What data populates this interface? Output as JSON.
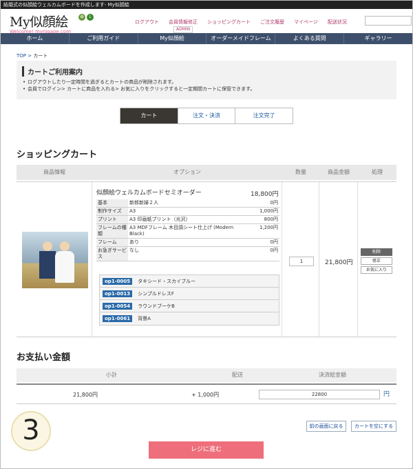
{
  "topbar": {
    "text": "結婚式の似顔絵ウェルカムボードを作成します- My似顔絵"
  },
  "logo": {
    "title": "My似顔絵",
    "subtitle": "Welcome! mynigaoe.com",
    "badge_left": "",
    "badge_right": "L"
  },
  "toplinks": [
    "ログアウト",
    "会員情報修正",
    "ショッピングカート",
    "ご注文履歴",
    "マイページ",
    "配送状況"
  ],
  "admin_label": "ADMIN",
  "nav": [
    "ホーム",
    "ご利用ガイド",
    "My似顔絵",
    "オーダーメイドフレーム",
    "よくある質問",
    "ギャラリー"
  ],
  "breadcrumb": {
    "top": "TOP",
    "sep": ">",
    "current": "カート"
  },
  "notice": {
    "title": "カートご利用案内",
    "items": [
      "ログアウトしたり一定時間を過ぎるとカートの商品が削除されます。",
      "会員でログイン> カートに商品を入れる> お気に入りをクリックすると一定期間カートに保管できます。"
    ]
  },
  "steps": [
    "カート",
    "注文・決済",
    "注文完了"
  ],
  "cart": {
    "heading": "ショッピングカート",
    "columns": [
      "商品情報",
      "オプション",
      "数量",
      "商品金額",
      "処理"
    ],
    "item": {
      "name": "似顔絵ウェルカムボードセミオーダー",
      "price": "18,800円",
      "options": [
        {
          "k": "基本",
          "v": "新郎新婦２人",
          "p": "0円"
        },
        {
          "k": "制作サイズ",
          "v": "A3",
          "p": "1,000円"
        },
        {
          "k": "プリント",
          "v": "A3 印画紙プリント（光沢）",
          "p": "800円"
        },
        {
          "k": "フレームの種類",
          "v": "A3 MDFフレーム 木目調シート仕上げ (Modern Black)",
          "p": "1,200円"
        },
        {
          "k": "フレーム",
          "v": "あり",
          "p": "0円"
        },
        {
          "k": "お急ぎサービス",
          "v": "なし",
          "p": "0円"
        }
      ],
      "sub_options": [
        {
          "code": "op1-0005",
          "label": "タキシード・スカイブルー"
        },
        {
          "code": "op1-0013",
          "label": "シンプルドレスF"
        },
        {
          "code": "op1-0054",
          "label": "ラウンドブーケB"
        },
        {
          "code": "op1-0061",
          "label": "背景A"
        }
      ],
      "quantity": "1",
      "amount": "21,800円",
      "actions": [
        "削除",
        "修正",
        "お気に入り"
      ]
    }
  },
  "payment": {
    "heading": "お支払い金額",
    "columns": [
      "小計",
      "配送",
      "決済総金額"
    ],
    "subtotal": "21,800円",
    "shipping": "+ 1,000円",
    "total": "22800",
    "yen": "円"
  },
  "step_number": "3",
  "buttons": {
    "back": "前の画面に戻る",
    "empty": "カートを空にする",
    "checkout": "レジに進む"
  }
}
